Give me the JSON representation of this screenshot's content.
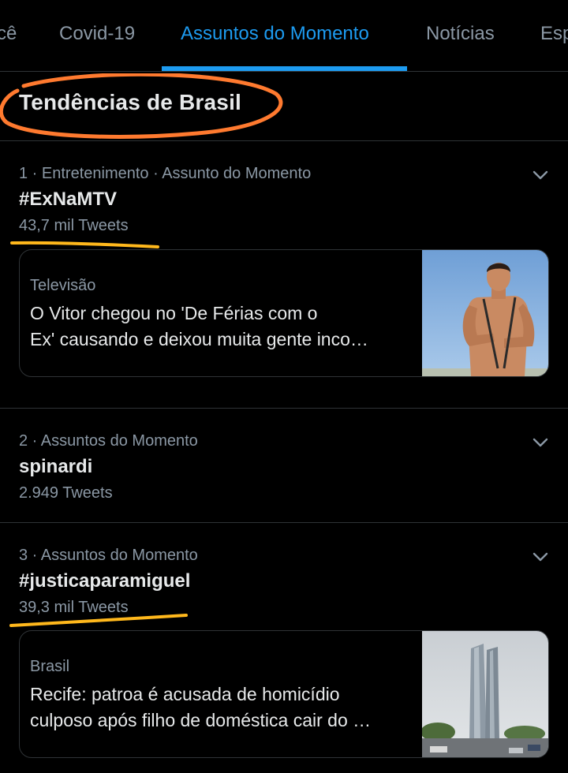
{
  "tabs": [
    {
      "label": "cê"
    },
    {
      "label": "Covid-19"
    },
    {
      "label": "Assuntos do Momento",
      "active": true
    },
    {
      "label": "Notícias"
    },
    {
      "label": "Esp"
    }
  ],
  "section": {
    "title": "Tendências de Brasil"
  },
  "trends": [
    {
      "meta": "1 · Entretenimento · Assunto do Momento",
      "name": "#ExNaMTV",
      "count": "43,7 mil Tweets",
      "card": {
        "category": "Televisão",
        "headline_line1": "O Vitor chegou no 'De Férias com o",
        "headline_line2": "Ex' causando e deixou muita gente inco…"
      }
    },
    {
      "meta": "2 · Assuntos do Momento",
      "name": "spinardi",
      "count": "2.949 Tweets"
    },
    {
      "meta": "3 · Assuntos do Momento",
      "name": "#justicaparamiguel",
      "count": "39,3 mil Tweets",
      "card": {
        "category": "Brasil",
        "headline_line1": "Recife: patroa é acusada de homicídio",
        "headline_line2": "culposo após filho de doméstica cair do …"
      }
    }
  ],
  "colors": {
    "background": "#000000",
    "accent": "#1d9bf0",
    "circle_annotation": "#ff7a2f",
    "underline_annotation": "#ffb81c",
    "muted_text": "#8b98a5",
    "primary_text": "#e7e9ea"
  },
  "icons": {
    "chevron": "chevron-down-icon"
  }
}
